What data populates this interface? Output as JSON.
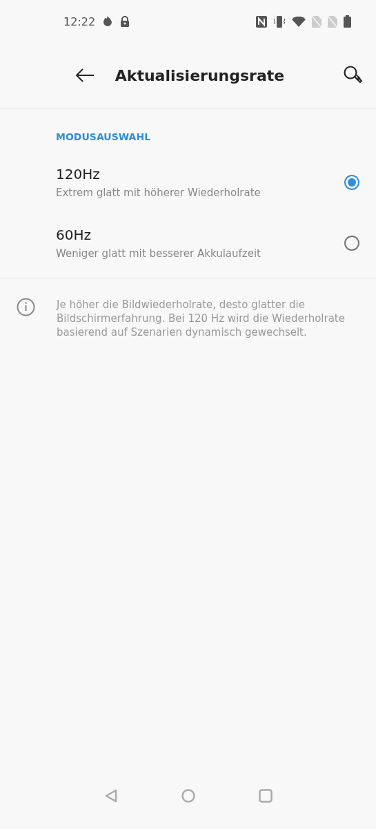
{
  "status_bar": {
    "time": "12:22"
  },
  "app_bar": {
    "title": "Aktualisierungsrate"
  },
  "mode_section": {
    "header": "MODUSAUSWAHL",
    "options": [
      {
        "label": "120Hz",
        "description": "Extrem glatt mit höherer Wiederholrate",
        "selected": true
      },
      {
        "label": "60Hz",
        "description": "Weniger glatt mit besserer Akkulaufzeit",
        "selected": false
      }
    ]
  },
  "info": {
    "text": "Je höher die Bildwiederholrate, desto glatter die Bildschirmerfahrung. Bei 120 Hz wird die Wiederholrate basierend auf Szenarien dynamisch gewechselt."
  }
}
